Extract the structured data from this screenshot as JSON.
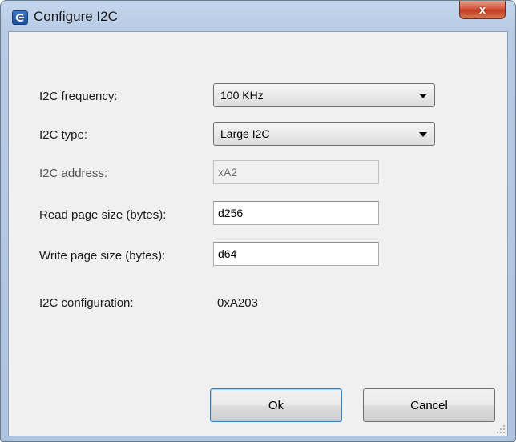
{
  "window": {
    "title": "Configure I2C",
    "close_label": "x"
  },
  "form": {
    "frequency": {
      "label": "I2C frequency:",
      "value": "100 KHz"
    },
    "type": {
      "label": "I2C type:",
      "value": "Large I2C"
    },
    "address": {
      "label": "I2C address:",
      "value": "xA2",
      "enabled": false
    },
    "read_page_size": {
      "label": "Read page size (bytes):",
      "value": "d256"
    },
    "write_page_size": {
      "label": "Write page size (bytes):",
      "value": "d64"
    },
    "configuration": {
      "label": "I2C configuration:",
      "value": "0xA203"
    }
  },
  "buttons": {
    "ok_label": "Ok",
    "cancel_label": "Cancel"
  },
  "icons": {
    "app": "cypress-app-icon",
    "close": "close-icon",
    "dropdown": "chevron-down-icon"
  }
}
